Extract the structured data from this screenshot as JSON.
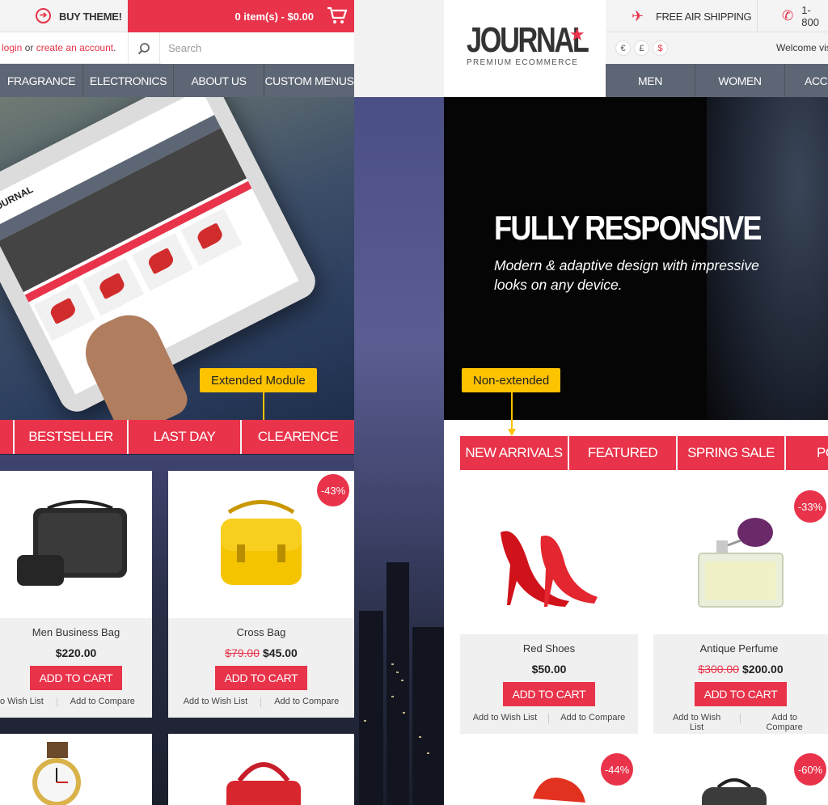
{
  "left_panel": {
    "buy_theme": "BUY THEME!",
    "cart_summary": "0 item(s) - $0.00",
    "account": {
      "login": "login",
      "or": " or ",
      "create": "create an account",
      "dot": "."
    },
    "search_placeholder": "Search",
    "nav": [
      "FRAGRANCE",
      "ELECTRONICS",
      "ABOUT US",
      "CUSTOM MENUS"
    ],
    "callout": "Extended Module",
    "tabs": [
      "BESTSELLER",
      "LAST DAY",
      "CLEARENCE"
    ],
    "products": [
      {
        "name": "Men Business Bag",
        "price": "$220.00",
        "old_price": "",
        "badge": ""
      },
      {
        "name": "Cross Bag",
        "price": "$45.00",
        "old_price": "$79.00",
        "badge": "-43%"
      }
    ]
  },
  "right_panel": {
    "logo": {
      "name": "JOURNAL",
      "star": "★",
      "tagline": "PREMIUM ECOMMERCE"
    },
    "shipping": "FREE AIR SHIPPING",
    "phone": "1-800",
    "currencies": [
      "€",
      "£",
      "$"
    ],
    "welcome": "Welcome vis",
    "nav": [
      "MEN",
      "WOMEN",
      "ACCES"
    ],
    "hero": {
      "title": "FULLY RESPONSIVE",
      "subtitle": "Modern & adaptive design with impressive looks on any device."
    },
    "callout": "Non-extended",
    "tabs": [
      "NEW ARRIVALS",
      "FEATURED",
      "SPRING SALE",
      "PO"
    ],
    "products": [
      {
        "name": "Red Shoes",
        "price": "$50.00",
        "old_price": "",
        "badge": ""
      },
      {
        "name": "Antique Perfume",
        "price": "$200.00",
        "old_price": "$300.00",
        "badge": "-33%"
      }
    ],
    "lower_badges": [
      "-44%",
      "-60%"
    ]
  },
  "common": {
    "add_to_cart": "ADD TO CART",
    "wish_list": "Add to Wish List",
    "wish_list_cut": "o Wish List",
    "compare": "Add to Compare"
  },
  "colors": {
    "accent": "#e8334a",
    "nav": "#5d6674",
    "callout": "#fdc200"
  }
}
